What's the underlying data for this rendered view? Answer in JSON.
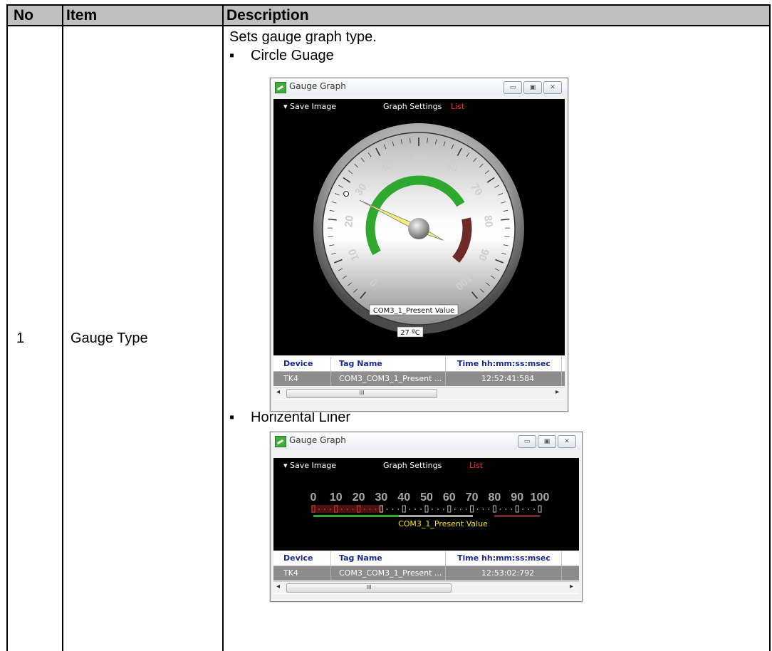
{
  "table": {
    "headers": {
      "no": "No",
      "item": "Item",
      "description": "Description"
    },
    "row": {
      "no": "1",
      "item": "Gauge Type",
      "intro": "Sets gauge graph type."
    }
  },
  "bullets": {
    "symbol": "▪",
    "circle": "Circle Guage",
    "linear": "Horizental Liner"
  },
  "window": {
    "title": "Gauge Graph",
    "buttons": {
      "minimize": "▭",
      "maximize": "▣",
      "close": "✕"
    },
    "menu": {
      "save": "▾  Save Image",
      "settings": "Graph Settings",
      "list": "List"
    },
    "grid": {
      "headers": {
        "device": "Device",
        "tag": "Tag Name",
        "time": "Time hh:mm:ss:msec"
      },
      "scroll_thumb": "III",
      "scroll_left": "◂",
      "scroll_right": "▸"
    }
  },
  "circle_gauge": {
    "scale_labels": [
      "0",
      "10",
      "20",
      "30",
      "40",
      "50",
      "60",
      "70",
      "80",
      "90",
      "100"
    ],
    "tag_label": "COM3_1_Present Value",
    "value_label": "27 ºC",
    "value": 27,
    "row": {
      "device": "TK4",
      "tag": "COM3_COM3_1_Present ...",
      "time": "12:52:41:584"
    }
  },
  "linear_gauge": {
    "scale_labels": [
      "0",
      "10",
      "20",
      "30",
      "40",
      "50",
      "60",
      "70",
      "80",
      "90",
      "100"
    ],
    "tag_label": "COM3_1_Present Value",
    "row": {
      "device": "TK4",
      "tag": "COM3_COM3_1_Present ...",
      "time": "12:53:02:792"
    }
  },
  "colors": {
    "header_bg": "#bfbfbf",
    "green_band": "#2fa82f",
    "red_band": "#6e2a26",
    "needle": "#f2f07a",
    "list_text": "#ff2a2a",
    "tag_label_yellow": "#f5e300"
  }
}
